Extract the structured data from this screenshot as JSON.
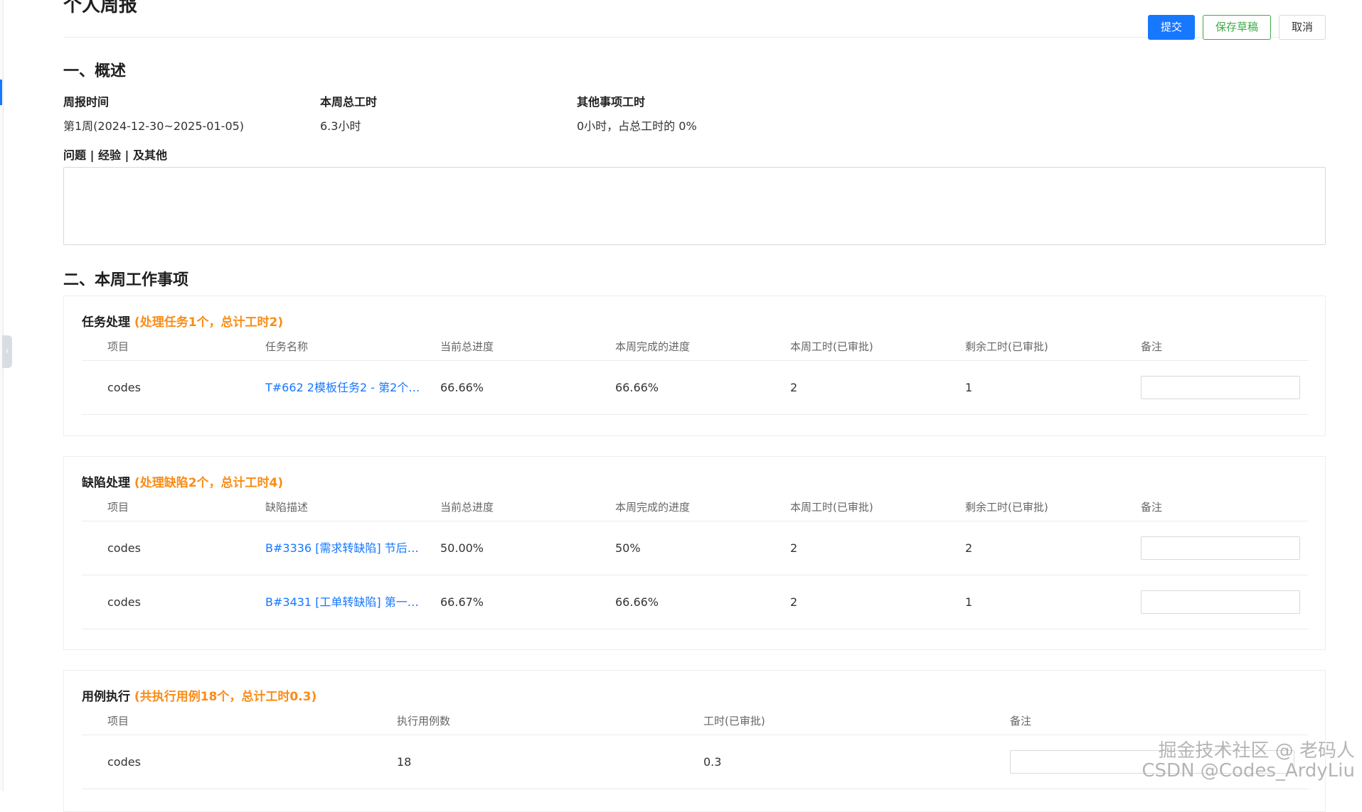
{
  "page": {
    "title": "个人周报"
  },
  "actions": {
    "submit_label": "提交",
    "save_draft_label": "保存草稿",
    "cancel_label": "取消"
  },
  "overview": {
    "heading": "一、概述",
    "week_time_label": "周报时间",
    "week_time_value": "第1周(2024-12-30~2025-01-05)",
    "total_hours_label": "本周总工时",
    "total_hours_value": "6.3小时",
    "other_hours_label": "其他事项工时",
    "other_hours_value": "0小时，占总工时的 0%",
    "notes_label": "问题 | 经验 | 及其他",
    "notes_value": ""
  },
  "work": {
    "heading": "二、本周工作事项",
    "tasks": {
      "title": "任务处理",
      "summary": "(处理任务1个，总计工时2)",
      "columns": [
        "项目",
        "任务名称",
        "当前总进度",
        "本周完成的进度",
        "本周工时(已审批)",
        "剩余工时(已审批)",
        "备注"
      ],
      "rows": [
        {
          "project": "codes",
          "name": "T#662 2模板任务2 - 第2个池...",
          "total_progress": "66.66%",
          "week_progress": "66.66%",
          "week_hours": "2",
          "remaining_hours": "1",
          "note": ""
        }
      ]
    },
    "defects": {
      "title": "缺陷处理",
      "summary": "(处理缺陷2个，总计工时4)",
      "columns": [
        "项目",
        "缺陷描述",
        "当前总进度",
        "本周完成的进度",
        "本周工时(已审批)",
        "剩余工时(已审批)",
        "备注"
      ],
      "rows": [
        {
          "project": "codes",
          "name": "B#3336 [需求转缺陷] 节后当...",
          "total_progress": "50.00%",
          "week_progress": "50%",
          "week_hours": "2",
          "remaining_hours": "2",
          "note": ""
        },
        {
          "project": "codes",
          "name": "B#3431 [工单转缺陷] 第一个...",
          "total_progress": "66.67%",
          "week_progress": "66.66%",
          "week_hours": "2",
          "remaining_hours": "1",
          "note": ""
        }
      ]
    },
    "cases": {
      "title": "用例执行",
      "summary": "(共执行用例18个，总计工时0.3)",
      "columns": [
        "项目",
        "执行用例数",
        "工时(已审批)",
        "备注"
      ],
      "rows": [
        {
          "project": "codes",
          "count": "18",
          "hours": "0.3",
          "note": ""
        }
      ]
    }
  },
  "watermark": {
    "line1": "掘金技术社区 @ 老码人",
    "line2": "CSDN @Codes_ArdyLiu"
  },
  "colors": {
    "primary": "#1677ff",
    "draft_green": "#3daa47",
    "summary_orange": "#fa8c16"
  }
}
